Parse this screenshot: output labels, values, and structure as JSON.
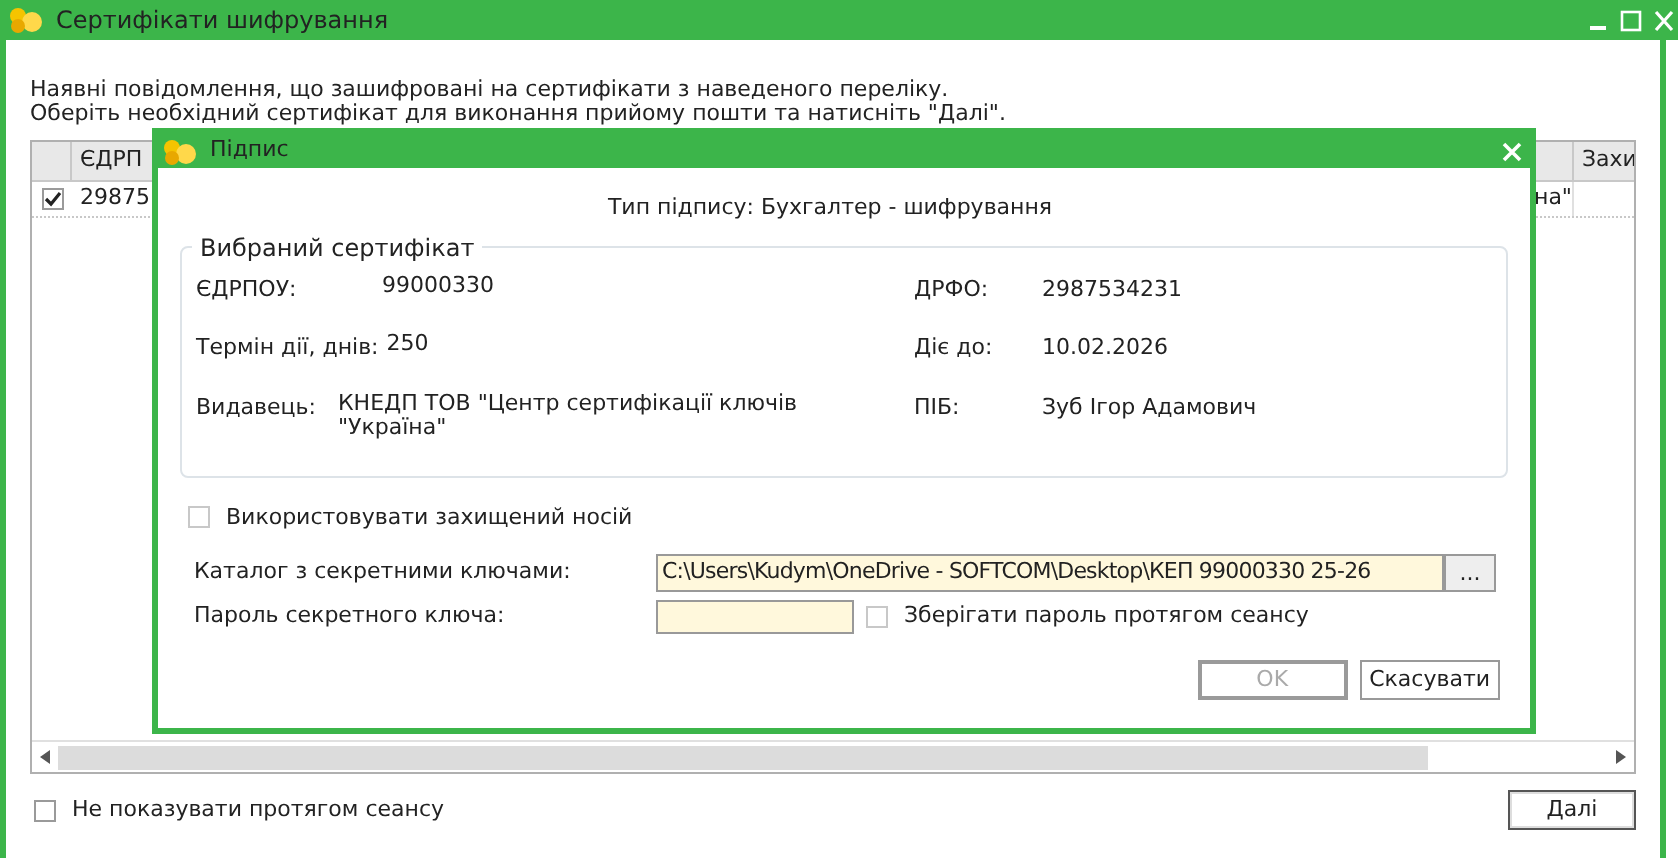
{
  "window": {
    "title": "Сертифікати шифрування"
  },
  "intro": [
    "Наявні повідомлення, що зашифровані на сертифікати з наведеного переліку.",
    "Оберіть необхідний сертифікат для виконання прийому пошти та натисніть \"Далі\"."
  ],
  "table": {
    "columns": [
      "ЄДРП",
      "Захи"
    ],
    "rows": [
      {
        "checked": true,
        "cells": [
          "29875",
          "на\""
        ]
      }
    ]
  },
  "dialog": {
    "title": "Підпис",
    "signature_type": "Тип підпису: Бухгалтер - шифрування",
    "certificate": {
      "title": "Вибраний сертифікат",
      "rows": [
        [
          {
            "label": "ЄДРПОУ:",
            "value": "99000330"
          },
          {
            "label": "ДРФО:",
            "value": "2987534231"
          }
        ],
        [
          {
            "label": "Термін дії, днів:",
            "value": "250"
          },
          {
            "label": "Діє до:",
            "value": "10.02.2026"
          }
        ],
        [
          {
            "label": "Видавець:",
            "value": "КНЕДП ТОВ \"Центр сертифікації ключів \"Україна\""
          },
          {
            "label": "ПІБ:",
            "value": "Зуб Ігор Адамович"
          }
        ]
      ]
    },
    "protected_media": {
      "label": "Використовувати захищений носій",
      "checked": false
    },
    "key_directory": {
      "label": "Каталог з секретними ключами:",
      "value": "C:\\Users\\Kudym\\OneDrive - SOFTCOM\\Desktop\\КЕП 99000330 25-26",
      "browse": "..."
    },
    "password": {
      "label": "Пароль секретного ключа:"
    },
    "save_password": {
      "label": "Зберігати пароль протягом сеансу",
      "checked": false
    },
    "buttons": [
      {
        "label": "OK",
        "disabled": true
      },
      {
        "label": "Скасувати",
        "disabled": false
      }
    ]
  },
  "footer": {
    "dont_show": {
      "label": "Не показувати протягом сеансу",
      "checked": false
    },
    "next": "Далі"
  }
}
